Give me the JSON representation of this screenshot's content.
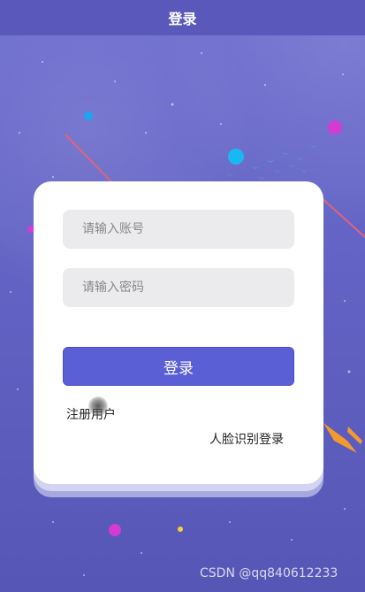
{
  "header": {
    "title": "登录"
  },
  "form": {
    "account_placeholder": "请输入账号",
    "password_placeholder": "请输入密码",
    "login_label": "登录",
    "register_label": "注册用户",
    "face_login_label": "人脸识别登录"
  },
  "watermark": "CSDN @qq840612233",
  "colors": {
    "header": "#5a59bb",
    "background": "#6464c6",
    "button": "#5b5fd6",
    "input": "#ebebed",
    "card": "#ffffff"
  }
}
